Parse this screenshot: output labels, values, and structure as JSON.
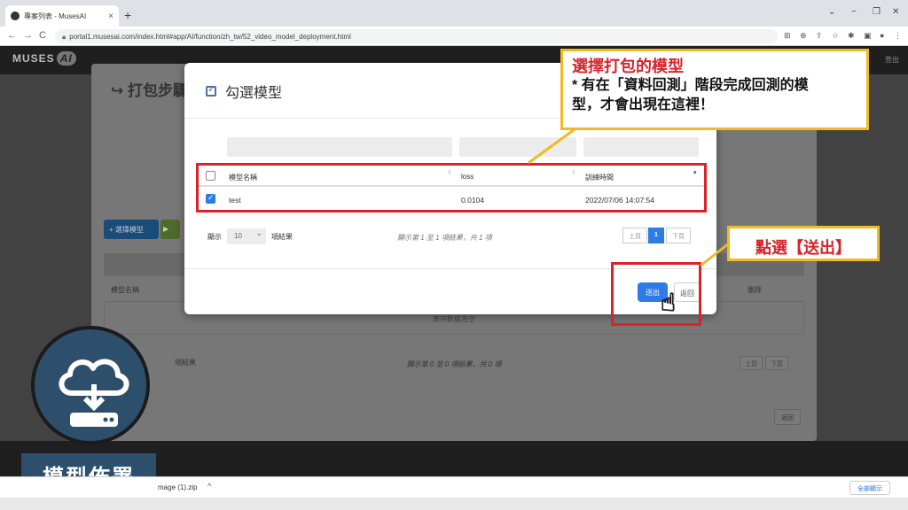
{
  "browser": {
    "tab_title": "專案列表 - MusesAI",
    "new_tab": "+",
    "url": "portal1.musesai.com/index.html#app/AI/function/zh_tw/52_video_model_deployment.html",
    "nav_back": "←",
    "nav_forward": "→",
    "nav_reload": "C"
  },
  "app": {
    "logo_text": "MUSES",
    "logo_ai": "AI",
    "header_right": "登出"
  },
  "background_panel": {
    "title": "打包步驟",
    "section1": "模型",
    "section2": "打包",
    "select_model_button": "選擇模型",
    "col_model_name": "模型名稱",
    "col_delete": "刪除",
    "empty_text": "表中數據為空",
    "info_text": "顯示第 0 至 0 項結果，共 0 項",
    "length_suffix": "項結果",
    "prev": "上頁",
    "next": "下頁",
    "back": "返回"
  },
  "modal": {
    "title": "勾選模型",
    "columns": {
      "name": "模型名稱",
      "loss": "loss",
      "time": "訓練時間"
    },
    "rows": [
      {
        "checked": true,
        "name": "test",
        "loss": "0.0104",
        "time": "2022/07/06 14:07:54"
      }
    ],
    "length_prefix": "顯示",
    "length_value": "10",
    "length_suffix": "項結果",
    "info_text": "顯示第 1 至 1 項結果，共 1 項",
    "pagination": {
      "prev": "上頁",
      "current": "1",
      "next": "下頁"
    },
    "submit_label": "送出",
    "back_label": "返回"
  },
  "annotations": {
    "callout1_head": "選擇打包的模型",
    "callout1_body1": "* 有在「資料回測」階段完成回測的模",
    "callout1_body2": "型，才會出現在這裡！",
    "callout2": "點選【送出】",
    "accent_red": "#d6242a",
    "accent_yellow": "#f0b928"
  },
  "badge": {
    "icon": "cloud-download-icon",
    "label": "模型佈署",
    "color": "#2d4f6b"
  },
  "downloads": {
    "file_name": "mage (1).zip",
    "show_all": "全部顯示"
  }
}
